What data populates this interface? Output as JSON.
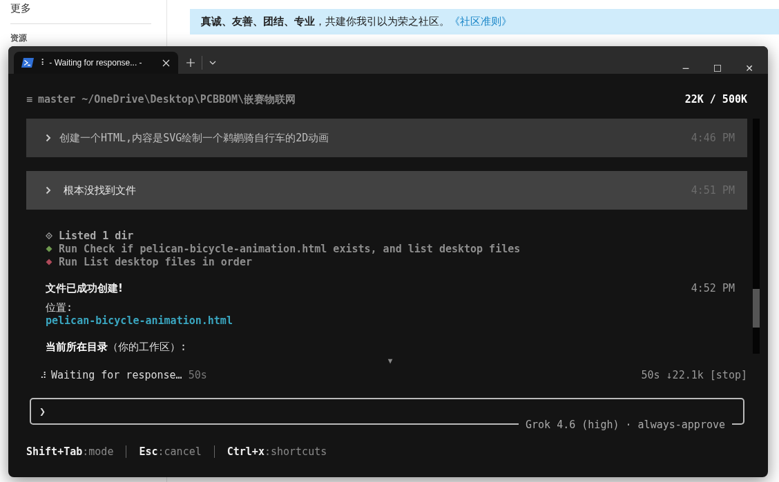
{
  "background": {
    "sidebar": {
      "items": [
        {
          "label": "更多",
          "kind": "item"
        },
        {
          "label": "资源",
          "kind": "heading"
        }
      ]
    },
    "banner": {
      "text": "**真诚、友善、团结、专业**，共建你我引以为荣之社区。",
      "link": "《社区准则》"
    }
  },
  "window": {
    "tabs": [
      {
        "title": "⠇ - Waiting for response... -",
        "selected": true
      }
    ],
    "controls": [
      "─",
      "☐",
      "✕"
    ]
  },
  "header": {
    "menu": "≡",
    "path": "master ~/OneDrive\\Desktop\\PCBBOM\\嵌赛物联网",
    "tokens": "22K / 500K"
  },
  "prompts": [
    {
      "text": "创建一个HTML,内容是SVG绘制一个鹈鹕骑自行车的2D动画",
      "time": "4:46 PM",
      "selected": false
    },
    {
      "text": "根本没找到文件",
      "time": "4:51 PM",
      "selected": true
    }
  ],
  "tool_calls": [
    {
      "kind": "outline",
      "color": "#9a9a9a",
      "text": "Listed 1 dir",
      "bold": true
    },
    {
      "kind": "filled",
      "color": "#6f9a4f",
      "text": "Run Check if pelican-bicycle-animation.html exists, and list desktop files",
      "bold": false
    },
    {
      "kind": "filled",
      "color": "#b04a5a",
      "text": "Run List desktop files in order",
      "bold": false
    }
  ],
  "response": {
    "heading": "文件已成功创建!",
    "time": "4:52 PM",
    "lines": [
      {
        "kind": "label",
        "text": "位置:"
      },
      {
        "kind": "link",
        "text": "pelican-bicycle-animation.html"
      },
      {
        "kind": "heading",
        "text": "**当前所在目录**（你的工作区）:"
      }
    ]
  },
  "scroll_hint": "▼",
  "status": {
    "spinner": "⠼",
    "text": "Waiting for response…",
    "elapsed": "50s",
    "stats": "50s ↓22.1k [stop]"
  },
  "input": {
    "prompt": "❯",
    "model": "Grok 4.6 (high) · always-approve"
  },
  "shortcuts": [
    {
      "key": "Shift+Tab",
      "action": ":mode"
    },
    {
      "key": "Esc",
      "action": ":cancel"
    },
    {
      "key": "Ctrl+x",
      "action": ":shortcuts"
    }
  ]
}
